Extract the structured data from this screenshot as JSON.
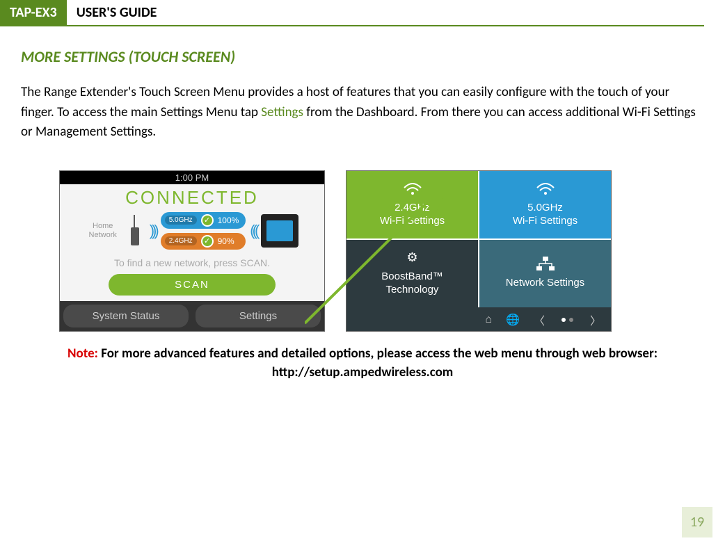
{
  "header": {
    "product": "TAP-EX3",
    "title": "USER'S GUIDE"
  },
  "section_title": "MORE SETTINGS (TOUCH SCREEN)",
  "intro": {
    "part1": "The Range Extender's Touch Screen Menu provides a host of features that you can easily configure with the touch of your finger. To access the main Settings Menu tap ",
    "settings_word": "Settings",
    "part2": " from the Dashboard. From there you can access additional Wi-Fi Settings or Management Settings."
  },
  "screenshot1": {
    "time": "1:00 PM",
    "status": "CONNECTED",
    "home_label": "Home\nNetwork",
    "band5": "5.0GHz",
    "pct5": "100%",
    "band24": "2.4GHz",
    "pct24": "90%",
    "find_text": "To find a new network, press SCAN.",
    "scan": "SCAN",
    "bottom_left": "System Status",
    "bottom_right": "Settings"
  },
  "screenshot2": {
    "tile1_line1": "2.4GHz",
    "tile1_line2": "Wi-Fi Settings",
    "tile2_line1": "5.0GHz",
    "tile2_line2": "Wi-Fi Settings",
    "tile3_line1": "BoostBand™",
    "tile3_line2": "Technology",
    "tile4": "Network Settings"
  },
  "note": {
    "label": "Note:",
    "text": " For more advanced features and detailed options, please access the web menu through web browser: http://setup.ampedwireless.com"
  },
  "page_number": "19"
}
